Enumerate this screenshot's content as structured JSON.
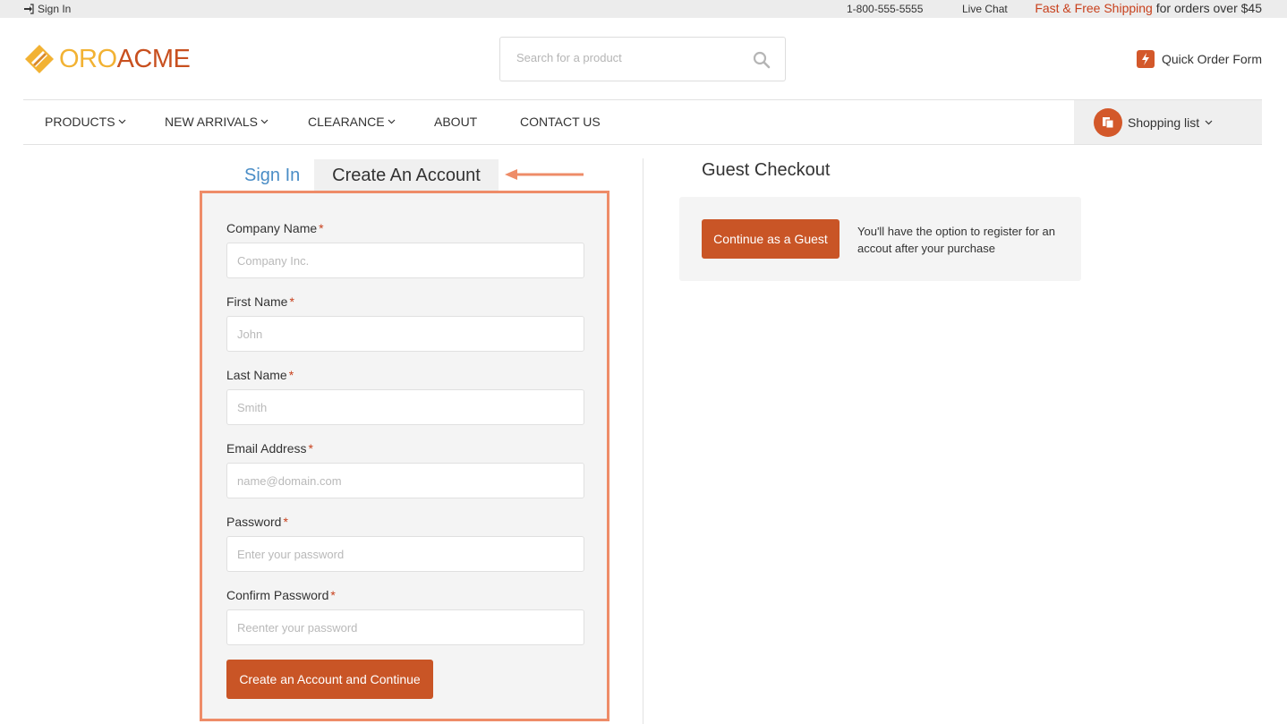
{
  "topbar": {
    "sign_in": "Sign In",
    "phone": "1-800-555-5555",
    "live_chat": "Live Chat",
    "shipping_highlight": "Fast & Free Shipping",
    "shipping_rest": " for orders over $45"
  },
  "header": {
    "logo_part1": "ORO",
    "logo_part2": "ACME",
    "search_placeholder": "Search for a product",
    "quick_order": "Quick Order Form"
  },
  "nav": {
    "items": [
      {
        "label": "PRODUCTS",
        "dropdown": true
      },
      {
        "label": "NEW ARRIVALS",
        "dropdown": true
      },
      {
        "label": "CLEARANCE",
        "dropdown": true
      },
      {
        "label": "ABOUT",
        "dropdown": false
      },
      {
        "label": "CONTACT US",
        "dropdown": false
      }
    ],
    "shopping_list": "Shopping list"
  },
  "tabs": {
    "sign_in": "Sign In",
    "create_account": "Create An Account"
  },
  "form": {
    "fields": [
      {
        "label": "Company Name",
        "placeholder": "Company Inc.",
        "required": "*"
      },
      {
        "label": "First Name",
        "placeholder": "John",
        "required": "*"
      },
      {
        "label": "Last Name",
        "placeholder": "Smith",
        "required": "*"
      },
      {
        "label": "Email Address",
        "placeholder": "name@domain.com",
        "required": "*"
      },
      {
        "label": "Password",
        "placeholder": "Enter your password",
        "required": "*"
      },
      {
        "label": "Confirm Password",
        "placeholder": "Reenter your password",
        "required": "*"
      }
    ],
    "submit": "Create an Account and Continue"
  },
  "guest": {
    "title": "Guest Checkout",
    "button": "Continue as a Guest",
    "note": "You'll have the option to register for an accout after your purchase"
  },
  "colors": {
    "accent": "#c95526",
    "highlight_border": "#ee8c68",
    "link": "#4a8dc6",
    "logo_yellow": "#f2b233"
  }
}
